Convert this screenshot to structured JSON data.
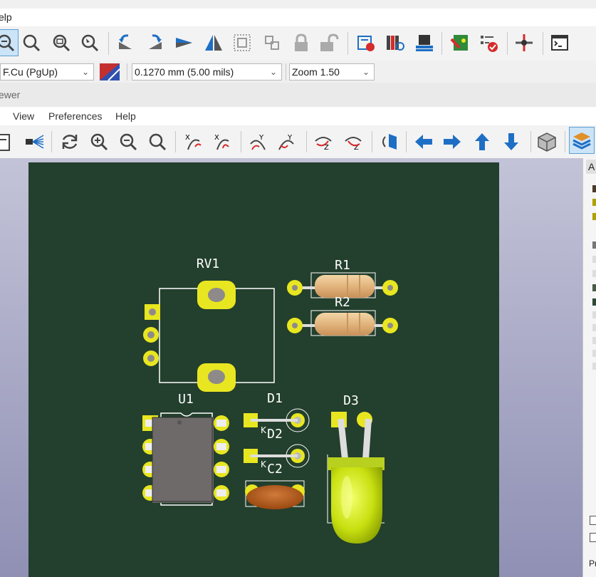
{
  "menubar_top": {
    "help_partial": "elp"
  },
  "toolbar1": {
    "items": [
      "zoom-selection-icon",
      "zoom-fit-icon",
      "zoom-objects-icon",
      "zoom-tool-icon",
      "rotate-ccw-icon",
      "rotate-cw-icon",
      "flip-icon",
      "mirror-icon",
      "group-icon",
      "ungroup-icon",
      "lock-icon",
      "unlock-icon",
      "schematic-editor-icon",
      "footprint-library-icon",
      "footprint-editor-icon",
      "board-setup-icon",
      "drc-icon",
      "netlist-icon",
      "scripting-console-icon"
    ]
  },
  "toolbar2": {
    "layer": "F.Cu (PgUp)",
    "track_width": "0.1270 mm (5.00 mils)",
    "zoom": "Zoom 1.50"
  },
  "viewer_title": "ewer",
  "menu2": {
    "view": "View",
    "preferences": "Preferences",
    "help": "Help"
  },
  "toolbar3": {
    "items": [
      "new-icon",
      "render-icon",
      "reload-icon",
      "zoom-in-icon",
      "zoom-out-icon",
      "zoom-fit-icon",
      "rotate-x-cw-icon",
      "rotate-x-ccw-icon",
      "rotate-y-cw-icon",
      "rotate-y-ccw-icon",
      "rotate-z-cw-icon",
      "rotate-z-ccw-icon",
      "flip-board-icon",
      "pan-left-icon",
      "pan-right-icon",
      "pan-up-icon",
      "pan-down-icon",
      "ortho-view-icon",
      "layers-icon"
    ]
  },
  "board": {
    "refs": {
      "rv1": "RV1",
      "r1": "R1",
      "r2": "R2",
      "u1": "U1",
      "d1": "D1",
      "d2": "D2",
      "d3": "D3",
      "c2": "C2"
    },
    "colors": {
      "board": "#233f2d",
      "pad": "#e8e620",
      "silk": "#ffffff",
      "body": "#6a6565"
    }
  },
  "right_panel": {
    "tab": "A",
    "footer": "Pr"
  }
}
